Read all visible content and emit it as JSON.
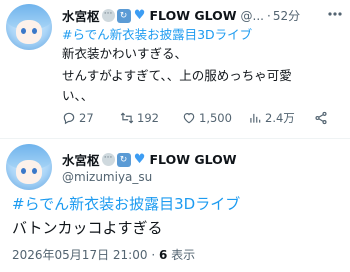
{
  "reply": {
    "display_name": "水宮枢",
    "name_suffix": "FLOW GLOW",
    "handle_short": "@...",
    "dot": "·",
    "time": "52分",
    "hashtag": "#らでん新衣装お披露目3Dライブ",
    "lines": [
      "新衣装かわいすぎる、",
      "せんすがよすぎて、、上の服めっちゃ可愛",
      "い、、"
    ],
    "stats": {
      "replies": "27",
      "retweets": "192",
      "likes": "1,500",
      "views": "2.4万"
    }
  },
  "main": {
    "display_name": "水宮枢",
    "name_suffix": "FLOW GLOW",
    "handle": "@mizumiya_su",
    "hashtag": "#らでん新衣装お披露目3Dライブ",
    "text": "バトンカッコよすぎる",
    "timestamp": "2026年05月17日 21:00",
    "dot": "·",
    "view_count": "6",
    "view_label": "表示"
  },
  "icons": {
    "more": "more-icon",
    "reply": "reply-icon",
    "retweet": "retweet-icon",
    "like": "heart-icon",
    "views": "views-icon",
    "share": "share-icon"
  },
  "colors": {
    "accent": "#1d9bf0",
    "muted": "#536471",
    "text": "#0f1419"
  }
}
